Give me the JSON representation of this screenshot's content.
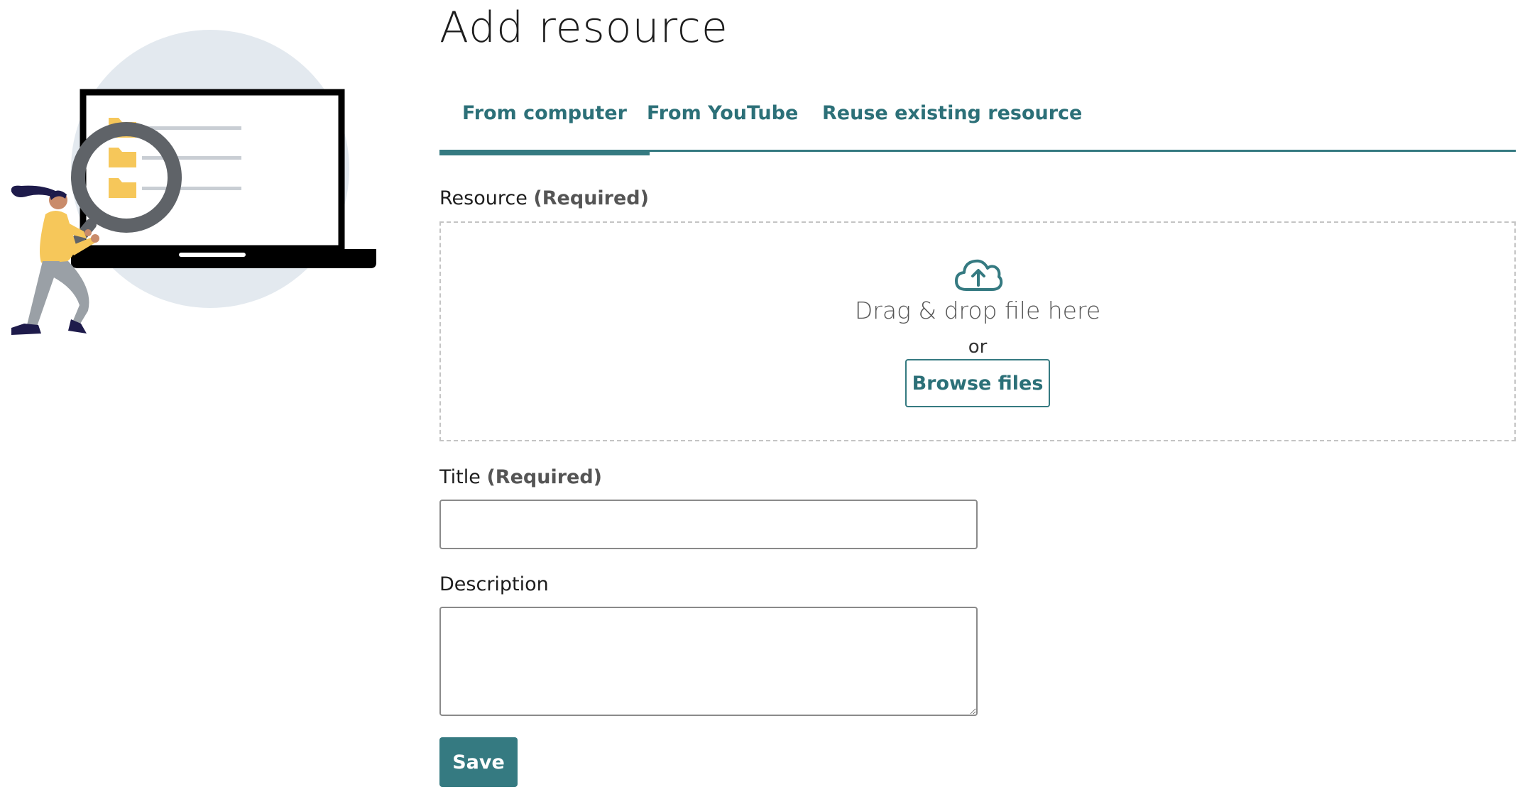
{
  "page": {
    "title": "Add resource"
  },
  "tabs": [
    {
      "label": "From computer",
      "active": true
    },
    {
      "label": "From YouTube",
      "active": false
    },
    {
      "label": "Reuse existing resource",
      "active": false
    }
  ],
  "resource_field": {
    "label": "Resource",
    "required_text": "(Required)",
    "drop_text": "Drag & drop file here",
    "or_text": "or",
    "browse_label": "Browse files",
    "icon": "cloud-upload-icon"
  },
  "title_field": {
    "label": "Title",
    "required_text": "(Required)",
    "value": "",
    "placeholder": ""
  },
  "description_field": {
    "label": "Description",
    "value": "",
    "placeholder": ""
  },
  "actions": {
    "save_label": "Save"
  },
  "illustration": {
    "icon": "person-searching-laptop-illustration"
  },
  "colors": {
    "accent": "#357a81",
    "accent_text": "#2c7078",
    "circle_bg": "#e3e9ef",
    "folder": "#f6c75a",
    "figure_top": "#f6c75a",
    "figure_pants": "#9aa0a6",
    "magnifier": "#5f6368"
  }
}
